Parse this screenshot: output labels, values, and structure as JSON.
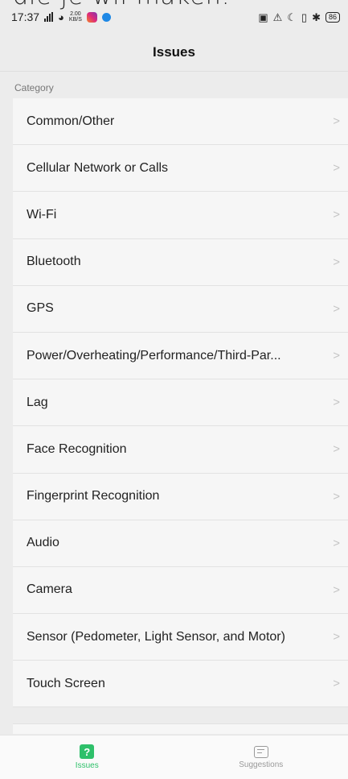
{
  "overlay_text": "die je wil maken.",
  "status_bar": {
    "time": "17:37",
    "speed": "2.00\nKB/S",
    "battery": "86"
  },
  "header": {
    "title": "Issues"
  },
  "category_label": "Category",
  "items": [
    "Common/Other",
    "Cellular Network or Calls",
    "Wi-Fi",
    "Bluetooth",
    "GPS",
    "Power/Overheating/Performance/Third-Par...",
    "Lag",
    "Face Recognition",
    "Fingerprint Recognition",
    "Audio",
    "Camera",
    "Sensor (Pedometer, Light Sensor, and Motor)",
    "Touch Screen"
  ],
  "tabs": {
    "issues": {
      "label": "Issues",
      "icon": "question-icon"
    },
    "suggestions": {
      "label": "Suggestions",
      "icon": "message-icon"
    }
  },
  "colors": {
    "accent": "#2ec06a",
    "background": "#ececec"
  }
}
